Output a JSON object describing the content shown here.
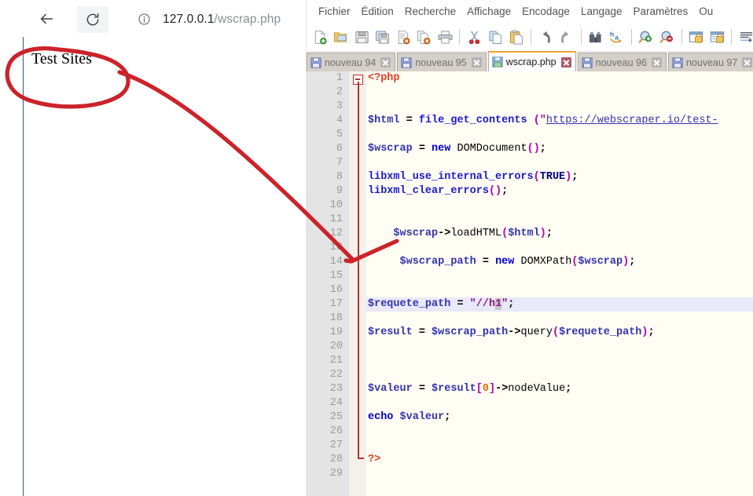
{
  "browser": {
    "back_icon": "arrow-left-icon",
    "reload_icon": "reload-icon",
    "info_icon": "info-circle-icon",
    "url_host": "127.0.0.1",
    "url_path": "/wscrap.php",
    "page_heading": "Test Sites"
  },
  "annotation": {
    "color": "#cc2229",
    "shapes": [
      "ellipse-around-test-sites",
      "curved-arrow-to-line-12"
    ]
  },
  "notepad": {
    "menu": [
      "Fichier",
      "Édition",
      "Recherche",
      "Affichage",
      "Encodage",
      "Langage",
      "Paramètres",
      "Ou"
    ],
    "toolbar": [
      {
        "name": "new-file-icon"
      },
      {
        "name": "open-file-icon"
      },
      {
        "name": "save-icon"
      },
      {
        "name": "save-all-icon"
      },
      {
        "name": "close-file-icon"
      },
      {
        "name": "close-all-icon"
      },
      {
        "name": "print-icon"
      },
      {
        "name": "separator"
      },
      {
        "name": "cut-icon"
      },
      {
        "name": "copy-icon"
      },
      {
        "name": "paste-icon"
      },
      {
        "name": "separator"
      },
      {
        "name": "undo-icon"
      },
      {
        "name": "redo-icon"
      },
      {
        "name": "separator"
      },
      {
        "name": "find-icon"
      },
      {
        "name": "replace-icon"
      },
      {
        "name": "separator"
      },
      {
        "name": "zoom-in-icon"
      },
      {
        "name": "zoom-out-icon"
      },
      {
        "name": "separator"
      },
      {
        "name": "sync-vertical-scroll-icon"
      },
      {
        "name": "sync-horizontal-scroll-icon"
      },
      {
        "name": "separator"
      },
      {
        "name": "word-wrap-icon"
      }
    ],
    "tabs": [
      {
        "label": "nouveau 94",
        "active": false
      },
      {
        "label": "nouveau 95",
        "active": false
      },
      {
        "label": "wscrap.php",
        "active": true
      },
      {
        "label": "nouveau 96",
        "active": false
      },
      {
        "label": "nouveau 97",
        "active": false
      }
    ],
    "editor": {
      "current_line": 17,
      "selected_text": "1",
      "line_numbers": [
        1,
        2,
        3,
        4,
        5,
        6,
        7,
        8,
        9,
        10,
        11,
        12,
        13,
        14,
        15,
        16,
        17,
        18,
        19,
        20,
        21,
        22,
        23,
        24,
        25,
        26,
        27,
        28,
        29
      ],
      "lines": {
        "1": "<?php",
        "4": "$html = file_get_contents (\"https://webscraper.io/test-",
        "6": "$wscrap = new DOMDocument();",
        "8": "libxml_use_internal_errors(TRUE);",
        "9": "libxml_clear_errors();",
        "12": "    $wscrap->loadHTML($html);",
        "14": "    $wscrap_path = new DOMXPath($wscrap);",
        "17": "$requete_path = \"//h1\";",
        "19": "$result = $wscrap_path->query($requete_path);",
        "23": "$valeur = $result[0]->nodeValue;",
        "25": "echo $valeur;",
        "28": "?>"
      }
    }
  }
}
